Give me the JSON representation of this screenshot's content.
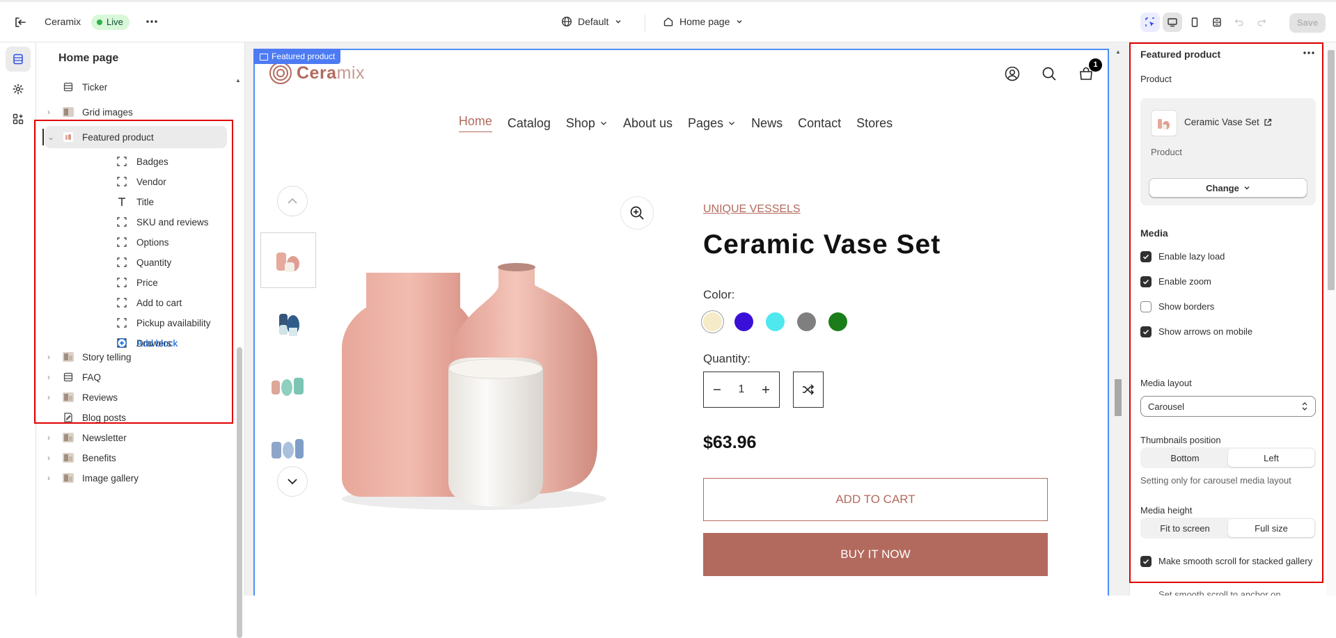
{
  "topbar": {
    "store_name": "Ceramix",
    "status": "Live",
    "theme": "Default",
    "page": "Home page",
    "save_label": "Save"
  },
  "left_panel": {
    "title": "Home page",
    "sections_before": [
      {
        "label": "Ticker",
        "icon": "list-icon",
        "expandable": false
      },
      {
        "label": "Grid images",
        "icon": "image-thumbnail-icon",
        "expandable": true
      }
    ],
    "selected_section": "Featured product",
    "blocks": [
      {
        "label": "Badges",
        "icon": "block-icon"
      },
      {
        "label": "Vendor",
        "icon": "block-icon"
      },
      {
        "label": "Title",
        "icon": "text-icon"
      },
      {
        "label": "SKU and reviews",
        "icon": "block-icon"
      },
      {
        "label": "Options",
        "icon": "block-icon"
      },
      {
        "label": "Quantity",
        "icon": "block-icon"
      },
      {
        "label": "Price",
        "icon": "block-icon"
      },
      {
        "label": "Add to cart",
        "icon": "block-icon"
      },
      {
        "label": "Pickup availability",
        "icon": "block-icon"
      },
      {
        "label": "Drawers",
        "icon": "block-icon"
      }
    ],
    "add_block": "Add block",
    "sections_after": [
      {
        "label": "Story telling",
        "icon": "image-thumbnail-icon",
        "expandable": true
      },
      {
        "label": "FAQ",
        "icon": "list-icon",
        "expandable": true
      },
      {
        "label": "Reviews",
        "icon": "image-thumbnail-icon",
        "expandable": true
      },
      {
        "label": "Blog posts",
        "icon": "blog-icon",
        "expandable": false
      },
      {
        "label": "Newsletter",
        "icon": "image-thumbnail-icon",
        "expandable": true
      },
      {
        "label": "Benefits",
        "icon": "image-thumbnail-icon",
        "expandable": true
      },
      {
        "label": "Image gallery",
        "icon": "image-thumbnail-icon",
        "expandable": true
      }
    ]
  },
  "preview": {
    "tag": "Featured product",
    "logo_main": "Cera",
    "logo_accent": "mix",
    "cart_count": "1",
    "nav": [
      {
        "label": "Home",
        "active": true,
        "dropdown": false
      },
      {
        "label": "Catalog",
        "active": false,
        "dropdown": false
      },
      {
        "label": "Shop",
        "active": false,
        "dropdown": true
      },
      {
        "label": "About us",
        "active": false,
        "dropdown": false
      },
      {
        "label": "Pages",
        "active": false,
        "dropdown": true
      },
      {
        "label": "News",
        "active": false,
        "dropdown": false
      },
      {
        "label": "Contact",
        "active": false,
        "dropdown": false
      },
      {
        "label": "Stores",
        "active": false,
        "dropdown": false
      }
    ],
    "product": {
      "vendor": "UNIQUE VESSELS",
      "title": "Ceramic Vase Set",
      "color_label": "Color:",
      "colors": [
        "#f5ebc8",
        "#3a10d8",
        "#4ee8ee",
        "#7f7f7f",
        "#1a7d1a"
      ],
      "quantity_label": "Quantity:",
      "quantity": "1",
      "price": "$63.96",
      "add_to_cart": "ADD TO CART",
      "buy_now": "BUY IT NOW"
    },
    "accent_color": "#b36a5e"
  },
  "right_panel": {
    "title": "Featured product",
    "product_label": "Product",
    "product_name": "Ceramic Vase Set",
    "product_sub": "Product",
    "change_label": "Change",
    "media_heading": "Media",
    "checkboxes": [
      {
        "label": "Enable lazy load",
        "checked": true
      },
      {
        "label": "Enable zoom",
        "checked": true
      },
      {
        "label": "Show borders",
        "checked": false
      },
      {
        "label": "Show arrows on mobile",
        "checked": true
      }
    ],
    "media_layout_label": "Media layout",
    "media_layout_value": "Carousel",
    "thumbs_label": "Thumbnails position",
    "thumbs_options": [
      "Bottom",
      "Left"
    ],
    "thumbs_selected": "Left",
    "thumbs_hint": "Setting only for carousel media layout",
    "height_label": "Media height",
    "height_options": [
      "Fit to screen",
      "Full size"
    ],
    "height_selected": "Full size",
    "smooth_scroll_label": "Make smooth scroll for stacked gallery",
    "smooth_scroll_checked": true,
    "smooth_hint": "Set smooth scroll to anchor on"
  }
}
